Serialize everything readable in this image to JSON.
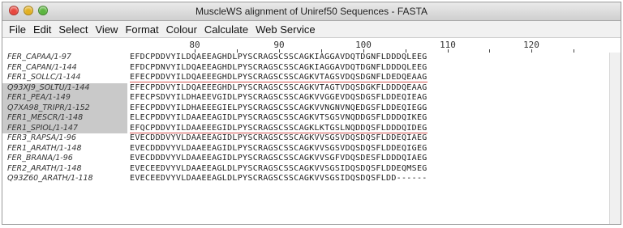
{
  "window": {
    "title": "MuscleWS alignment of Uniref50 Sequences - FASTA"
  },
  "menu": [
    {
      "label": "File"
    },
    {
      "label": "Edit"
    },
    {
      "label": "Select"
    },
    {
      "label": "View"
    },
    {
      "label": "Format"
    },
    {
      "label": "Colour"
    },
    {
      "label": "Calculate"
    },
    {
      "label": "Web Service"
    }
  ],
  "ruler": [
    "80",
    "90",
    "100",
    "110",
    "120"
  ],
  "sequences": [
    {
      "name": "FER_CAPAA/1-97",
      "residues": "EFDCPDDVYILDQAEEAGHDLPYSCRAGSCSSCAGKIAGGAVDQTDGNFLDDDQLEEG",
      "selected": false
    },
    {
      "name": "FER_CAPAN/1-144",
      "residues": "EFDCPDNVYILDQAEEAGHDLPYSCRAGSCSSCAGKIAGGAVDQTDGNFLDDDQLEEG",
      "selected": false
    },
    {
      "name": "FER1_SOLLC/1-144",
      "residues": "EFECPDDVYILDQAEEEGHDLPYSCRAGSCSSCAGKVTAGSVDQSDGNFLDEDQEAAG",
      "selected": false
    },
    {
      "name": "Q93XJ9_SOLTU/1-144",
      "residues": "EFECPDDVYILDQAEEEGHDLPYSCRAGSCSSCAGKVTAGTVDQSDGKFLDDDQEAAG",
      "selected": true
    },
    {
      "name": "FER1_PEA/1-149",
      "residues": "EFECPSDVYILDHAEEVGIDLPYSCRAGSCSSCAGKVVGGEVDQSDGSFLDDEQIEAG",
      "selected": true
    },
    {
      "name": "Q7XA98_TRIPR/1-152",
      "residues": "EFECPDDVYILDHAEEEGIELPYSCRAGSCSSCAGKVVNGNVNQEDGSFLDDEQIEGG",
      "selected": true
    },
    {
      "name": "FER1_MESCR/1-148",
      "residues": "ELECPDDVYILDAAEEAGIDLPYSCRAGSCSSCAGKVTSGSVNQDDGSFLDDDQIKEG",
      "selected": true
    },
    {
      "name": "FER1_SPIOL/1-147",
      "residues": "EFQCPDDVYILDAAEEEGIDLPYSCRAGSCSSCAGKLKTGSLNQDDQSFLDDDQIDEG",
      "selected": true
    },
    {
      "name": "FER3_RAPSA/1-96",
      "residues": "EVECDDDVYVLDAAEEAGIDLPYSCRAGSCSSCAGKVVSGSVDQSDQSFLDDEQIAEG",
      "selected": false
    },
    {
      "name": "FER1_ARATH/1-148",
      "residues": "EVECDDDVYVLDAAEEAGIDLPYSCRAGSCSSCAGKVVSGSVDQSDQSFLDDEQIGEG",
      "selected": false
    },
    {
      "name": "FER_BRANA/1-96",
      "residues": "EVECDDDVYVLDAAEEAGIDLPYSCRAGSCSSCAGKVVSGFVDQSDESFLDDDQIAEG",
      "selected": false
    },
    {
      "name": "FER2_ARATH/1-148",
      "residues": "EVECEEDVYVLDAAEEAGLDLPYSCRAGSCSSCAGKVVSGSIDQSDQSFLDDEQMSEG",
      "selected": false
    },
    {
      "name": "Q93Z60_ARATH/1-118",
      "residues": "EVECEEDVYVLDAAEEAGLDLPYSCRAGSCSSCAGKVVSGSIDQSDQSFLDD------",
      "selected": false
    }
  ]
}
